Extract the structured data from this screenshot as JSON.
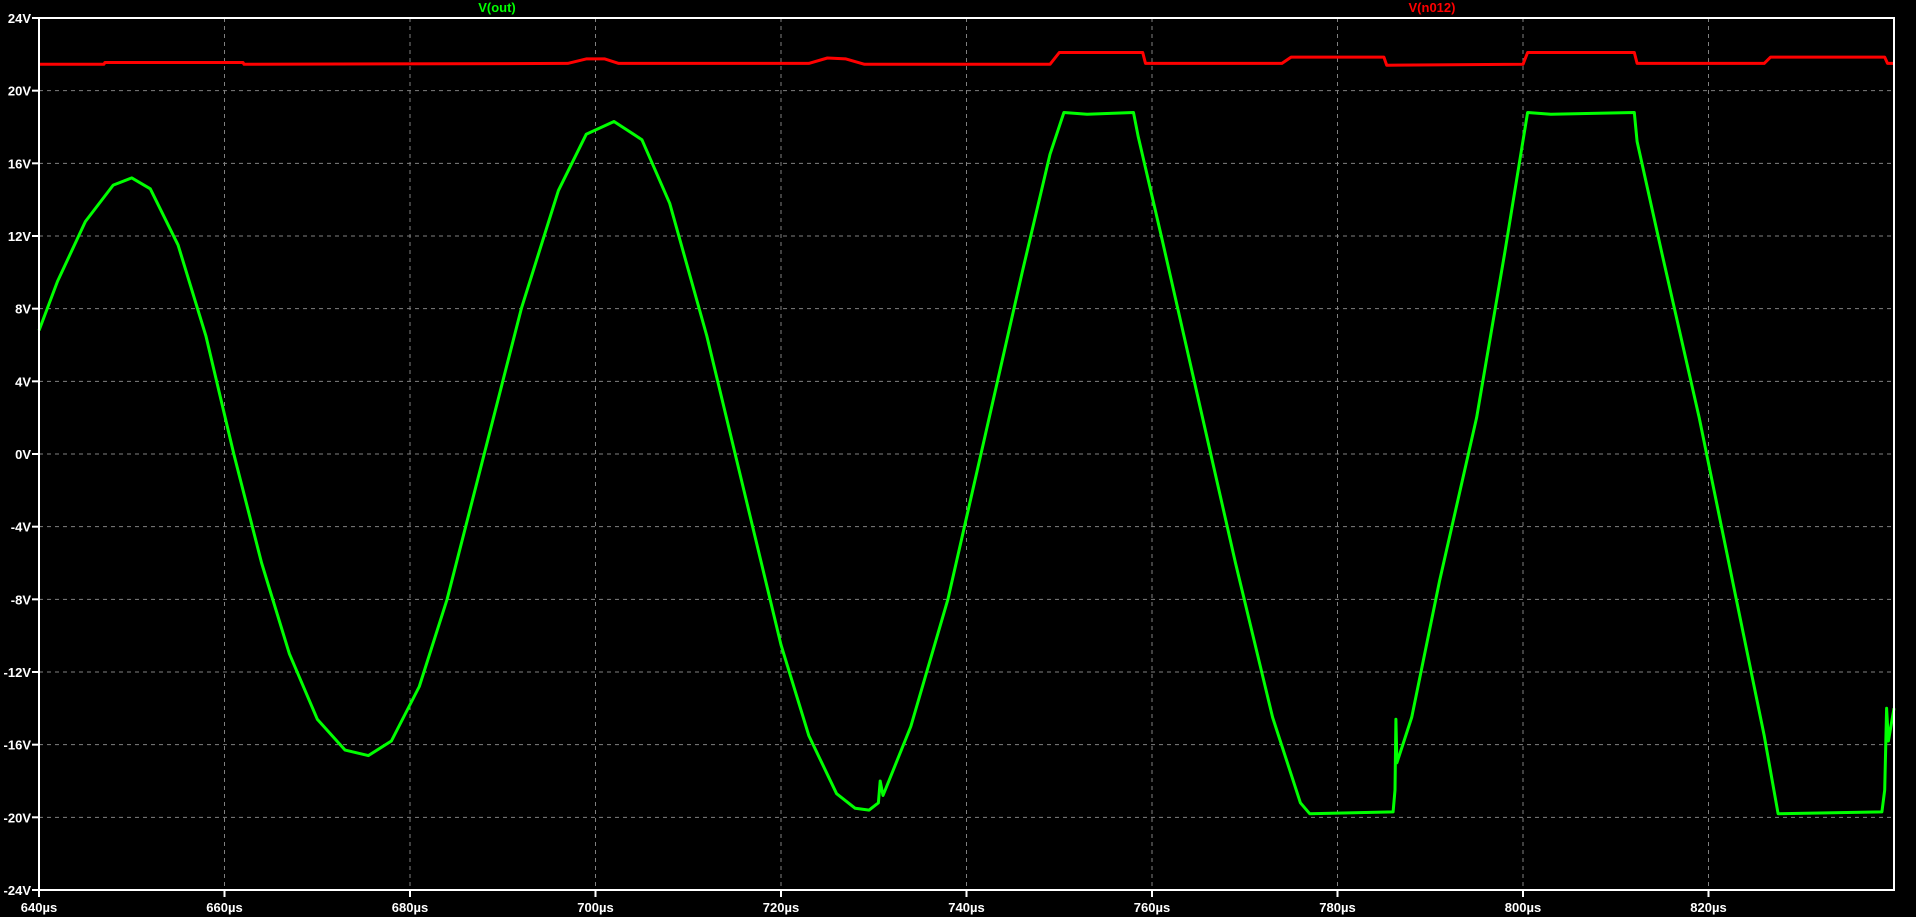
{
  "chart_data": {
    "type": "line",
    "title": "",
    "xlabel": "",
    "ylabel": "",
    "xlim": [
      640,
      840
    ],
    "ylim": [
      -24,
      24
    ],
    "grid": true,
    "x_ticks": [
      640,
      660,
      680,
      700,
      720,
      740,
      760,
      780,
      800,
      820
    ],
    "x_tick_labels": [
      "640µs",
      "660µs",
      "680µs",
      "700µs",
      "720µs",
      "740µs",
      "760µs",
      "780µs",
      "800µs",
      "820µs"
    ],
    "y_ticks": [
      24,
      20,
      16,
      12,
      8,
      4,
      0,
      -4,
      -8,
      -12,
      -16,
      -20,
      -24
    ],
    "y_tick_labels": [
      "24V",
      "20V",
      "16V",
      "12V",
      "8V",
      "4V",
      "0V",
      "-4V",
      "-8V",
      "-12V",
      "-16V",
      "-20V",
      "-24V"
    ],
    "series": [
      {
        "name": "V(out)",
        "color": "#00ff00",
        "points": [
          [
            640,
            6.8
          ],
          [
            642,
            9.5
          ],
          [
            645,
            12.8
          ],
          [
            648,
            14.8
          ],
          [
            650,
            15.2
          ],
          [
            652,
            14.6
          ],
          [
            655,
            11.5
          ],
          [
            658,
            6.5
          ],
          [
            661,
            0
          ],
          [
            664,
            -6
          ],
          [
            667,
            -11
          ],
          [
            670,
            -14.6
          ],
          [
            673,
            -16.3
          ],
          [
            675.5,
            -16.6
          ],
          [
            678,
            -15.8
          ],
          [
            681,
            -12.8
          ],
          [
            684,
            -8
          ],
          [
            688,
            0
          ],
          [
            692,
            8
          ],
          [
            696,
            14.5
          ],
          [
            699,
            17.6
          ],
          [
            702,
            18.3
          ],
          [
            705,
            17.3
          ],
          [
            708,
            13.8
          ],
          [
            712,
            6.5
          ],
          [
            716,
            -2
          ],
          [
            720,
            -10.5
          ],
          [
            723,
            -15.5
          ],
          [
            726,
            -18.7
          ],
          [
            728,
            -19.5
          ],
          [
            729.5,
            -19.6
          ],
          [
            730.5,
            -19.2
          ],
          [
            730.7,
            -18
          ],
          [
            731,
            -18.8
          ],
          [
            734,
            -15
          ],
          [
            738,
            -8
          ],
          [
            742,
            1
          ],
          [
            746,
            10
          ],
          [
            749,
            16.5
          ],
          [
            750.5,
            18.8
          ],
          [
            753,
            18.7
          ],
          [
            758,
            18.8
          ],
          [
            758.5,
            17.5
          ],
          [
            761,
            12
          ],
          [
            765,
            3
          ],
          [
            769,
            -6
          ],
          [
            773,
            -14.5
          ],
          [
            776,
            -19.2
          ],
          [
            777,
            -19.8
          ],
          [
            786,
            -19.7
          ],
          [
            786.2,
            -18.5
          ],
          [
            786.3,
            -14.6
          ],
          [
            786.4,
            -17
          ],
          [
            788,
            -14.5
          ],
          [
            791,
            -7
          ],
          [
            795,
            2
          ],
          [
            798,
            11
          ],
          [
            800.5,
            18.8
          ],
          [
            803,
            18.7
          ],
          [
            812,
            18.8
          ],
          [
            812.3,
            17.2
          ],
          [
            815,
            11
          ],
          [
            819,
            2
          ],
          [
            823,
            -8
          ],
          [
            826,
            -15.5
          ],
          [
            827.5,
            -19.8
          ],
          [
            838.7,
            -19.7
          ],
          [
            839,
            -18.5
          ],
          [
            839.2,
            -14
          ],
          [
            839.4,
            -15.8
          ],
          [
            840,
            -14
          ]
        ]
      },
      {
        "name": "V(n012)",
        "color": "#ff0000",
        "points": [
          [
            640,
            21.45
          ],
          [
            647,
            21.45
          ],
          [
            647.1,
            21.55
          ],
          [
            662,
            21.55
          ],
          [
            662.1,
            21.45
          ],
          [
            697,
            21.5
          ],
          [
            699,
            21.75
          ],
          [
            701,
            21.75
          ],
          [
            702.5,
            21.5
          ],
          [
            723,
            21.5
          ],
          [
            725,
            21.8
          ],
          [
            727,
            21.75
          ],
          [
            729,
            21.45
          ],
          [
            749,
            21.45
          ],
          [
            750,
            22.1
          ],
          [
            759,
            22.1
          ],
          [
            759.3,
            21.5
          ],
          [
            774,
            21.5
          ],
          [
            775,
            21.85
          ],
          [
            785,
            21.85
          ],
          [
            785.3,
            21.4
          ],
          [
            800,
            21.45
          ],
          [
            800.5,
            22.1
          ],
          [
            812,
            22.1
          ],
          [
            812.3,
            21.5
          ],
          [
            826,
            21.5
          ],
          [
            826.7,
            21.85
          ],
          [
            839,
            21.85
          ],
          [
            839.3,
            21.5
          ],
          [
            840,
            21.5
          ]
        ]
      }
    ]
  }
}
